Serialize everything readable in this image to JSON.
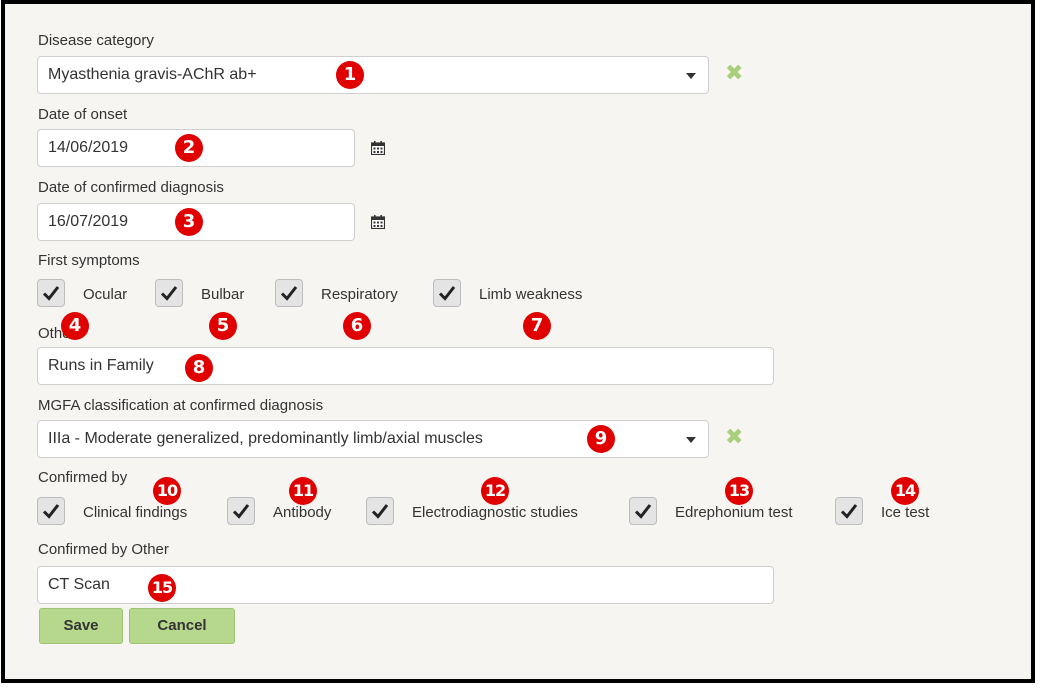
{
  "disease_category": {
    "label": "Disease category",
    "value": "Myasthenia gravis-AChR ab+",
    "clear_icon": "x-icon"
  },
  "date_onset": {
    "label": "Date of onset",
    "value": "14/06/2019",
    "icon": "calendar-icon"
  },
  "date_confirmed": {
    "label": "Date of confirmed diagnosis",
    "value": "16/07/2019",
    "icon": "calendar-icon"
  },
  "first_symptoms": {
    "label": "First symptoms",
    "options": [
      {
        "label": "Ocular",
        "checked": true
      },
      {
        "label": "Bulbar",
        "checked": true
      },
      {
        "label": "Respiratory",
        "checked": true
      },
      {
        "label": "Limb weakness",
        "checked": true
      }
    ]
  },
  "other": {
    "label": "Other",
    "value": "Runs in Family"
  },
  "mgfa": {
    "label": "MGFA classification at confirmed diagnosis",
    "value": "IIIa - Moderate generalized, predominantly limb/axial muscles"
  },
  "confirmed_by": {
    "label": "Confirmed by",
    "options": [
      {
        "label": "Clinical findings",
        "checked": true
      },
      {
        "label": "Antibody",
        "checked": true
      },
      {
        "label": "Electrodiagnostic studies",
        "checked": true
      },
      {
        "label": "Edrephonium test",
        "checked": true
      },
      {
        "label": "Ice test",
        "checked": true
      }
    ]
  },
  "confirmed_by_other": {
    "label": "Confirmed by Other",
    "value": "CT Scan"
  },
  "buttons": {
    "save": "Save",
    "cancel": "Cancel"
  },
  "annotations": [
    "1",
    "2",
    "3",
    "4",
    "5",
    "6",
    "7",
    "8",
    "9",
    "10",
    "11",
    "12",
    "13",
    "14",
    "15"
  ],
  "colors": {
    "panel_bg": "#f6f5f1",
    "button_green": "#b5d88d",
    "clear_x_green": "#a9cf7a",
    "badge_red": "#e00000"
  }
}
